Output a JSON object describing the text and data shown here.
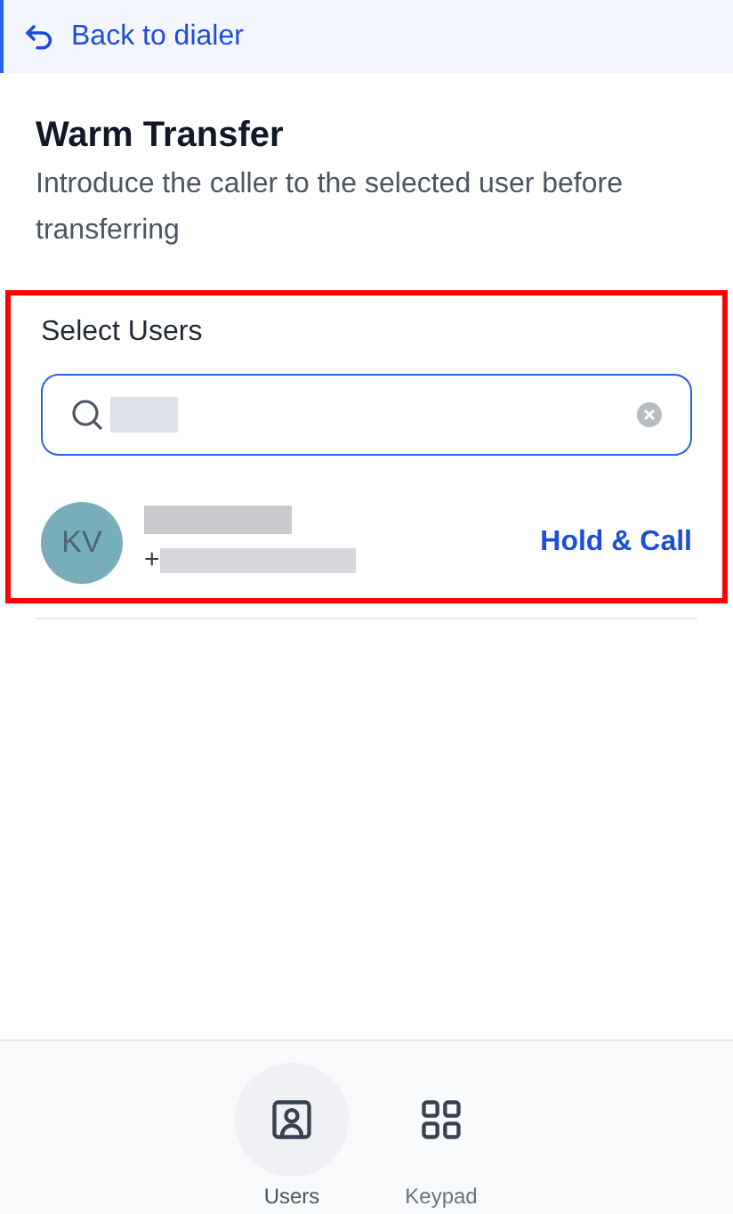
{
  "back_link": {
    "label": "Back to dialer"
  },
  "header": {
    "title": "Warm Transfer",
    "subtitle": "Introduce the caller to the selected user before transferring"
  },
  "select_users": {
    "label": "Select Users",
    "highlighted": true,
    "search": {
      "focused": true
    },
    "results": [
      {
        "initials": "KV",
        "phone_prefix": "+",
        "action": "Hold & Call"
      }
    ]
  },
  "bottom_nav": [
    {
      "kind": "users",
      "label": "Users",
      "selected": true
    },
    {
      "kind": "keypad",
      "label": "Keypad",
      "selected": false
    }
  ]
}
